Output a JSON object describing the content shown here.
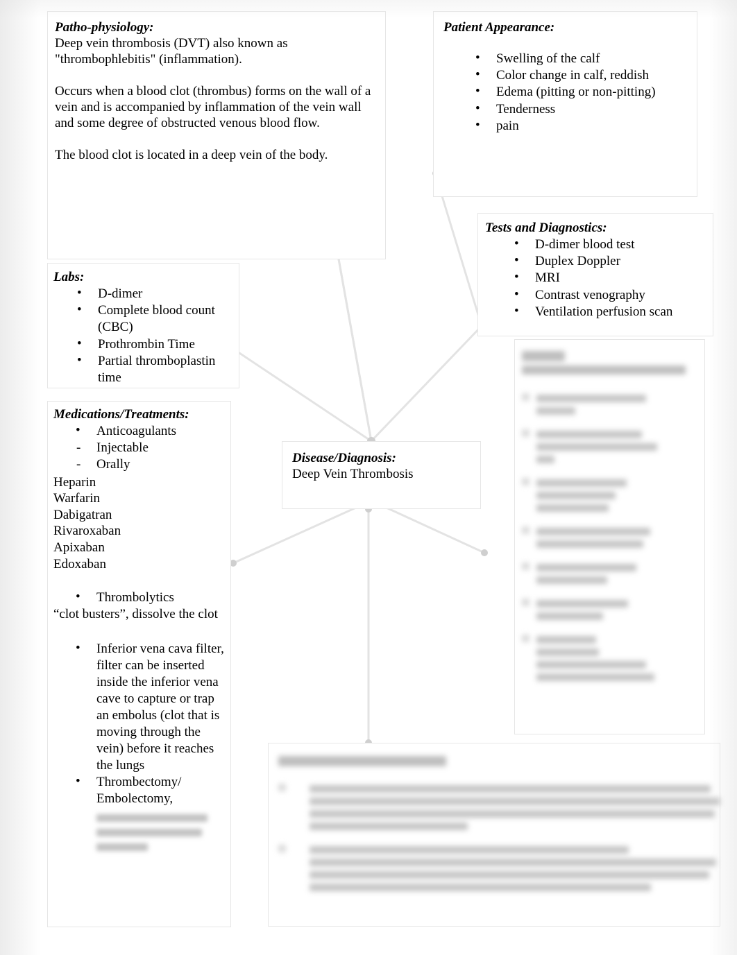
{
  "document": {
    "type": "concept-map",
    "title": "Deep Vein Thrombosis Concept Map"
  },
  "colors": {
    "page_background": "#ffffff",
    "box_border": "#e6e6e6",
    "connector_line": "#e3e3e3",
    "connector_node": "#cfcfcf",
    "text": "#000000",
    "redacted_text": "#9a9a9a"
  },
  "pathophysiology": {
    "heading": "Patho-physiology:",
    "paragraphs": [
      "Deep vein thrombosis (DVT) also known as \"thrombophlebitis\" (inflammation).",
      "Occurs when a blood clot (thrombus) forms on the wall of a vein and is accompanied by inflammation of the vein wall and some degree of obstructed venous blood flow.",
      "The blood clot is located in a deep vein of the body."
    ],
    "text": "Deep vein thrombosis (DVT) also known as \"thrombophlebitis\" (inflammation).\n\nOccurs when a blood clot (thrombus) forms on the wall of a vein and is accompanied by inflammation of the vein wall and some degree of obstructed venous blood flow.\n\nThe blood clot is located in a deep vein of the body."
  },
  "patient_appearance": {
    "heading": "Patient Appearance:",
    "items": [
      "Swelling of the calf",
      "Color change in calf, reddish",
      "Edema (pitting or non-pitting)",
      "Tenderness",
      "pain"
    ]
  },
  "tests_and_diagnostics": {
    "heading": "Tests and Diagnostics:",
    "items": [
      "D-dimer blood test",
      "Duplex Doppler",
      "MRI",
      "Contrast venography",
      "Ventilation perfusion scan"
    ]
  },
  "labs": {
    "heading": "Labs:",
    "items": [
      "D-dimer",
      "Complete blood count (CBC)",
      "Prothrombin Time",
      "Partial thromboplastin time"
    ]
  },
  "medications_treatments": {
    "heading": "Medications/Treatments:",
    "items": [
      {
        "marker": "bullet",
        "text": "Anticoagulants"
      },
      {
        "marker": "dash",
        "text": "Injectable"
      },
      {
        "marker": "dash",
        "text": "Orally"
      }
    ],
    "drug_list": [
      "Heparin",
      "Warfarin",
      "Dabigatran",
      "Rivaroxaban",
      "Apixaban",
      "Edoxaban"
    ],
    "thrombolytics": {
      "bullet": "Thrombolytics",
      "note": "“clot busters”, dissolve the clot"
    },
    "ivc_filter": "Inferior vena cava filter, filter can be inserted inside the inferior vena cave to capture or trap an embolus (clot that is moving through the vein) before it reaches the lungs",
    "thrombectomy": "Thrombectomy/ Embolectomy,",
    "redacted_tail": {
      "state": "blurred",
      "line_count": 3
    }
  },
  "disease_diagnosis": {
    "heading": "Disease/Diagnosis:",
    "value": "Deep Vein Thrombosis"
  },
  "nursing_responsibilities": {
    "heading_visible": "Nursing",
    "state": "blurred",
    "subtitle_redacted": true,
    "bullet_count": 7,
    "bullet_line_counts": [
      2,
      2,
      3,
      2,
      2,
      2,
      3
    ]
  },
  "nursing_interventions": {
    "heading_state": "blurred",
    "state": "blurred",
    "bullet_count": 2,
    "bullet_line_counts": [
      4,
      4
    ]
  },
  "connectors": {
    "description": "Lines radiating from the Disease/Diagnosis node to surrounding boxes",
    "edges": [
      {
        "from": "disease-diagnosis",
        "to": "pathophysiology"
      },
      {
        "from": "disease-diagnosis",
        "to": "patient-appearance"
      },
      {
        "from": "disease-diagnosis",
        "to": "tests-and-diagnostics"
      },
      {
        "from": "disease-diagnosis",
        "to": "labs"
      },
      {
        "from": "disease-diagnosis",
        "to": "medications-treatments"
      },
      {
        "from": "disease-diagnosis",
        "to": "nursing-responsibilities"
      },
      {
        "from": "disease-diagnosis",
        "to": "nursing-interventions"
      }
    ]
  }
}
